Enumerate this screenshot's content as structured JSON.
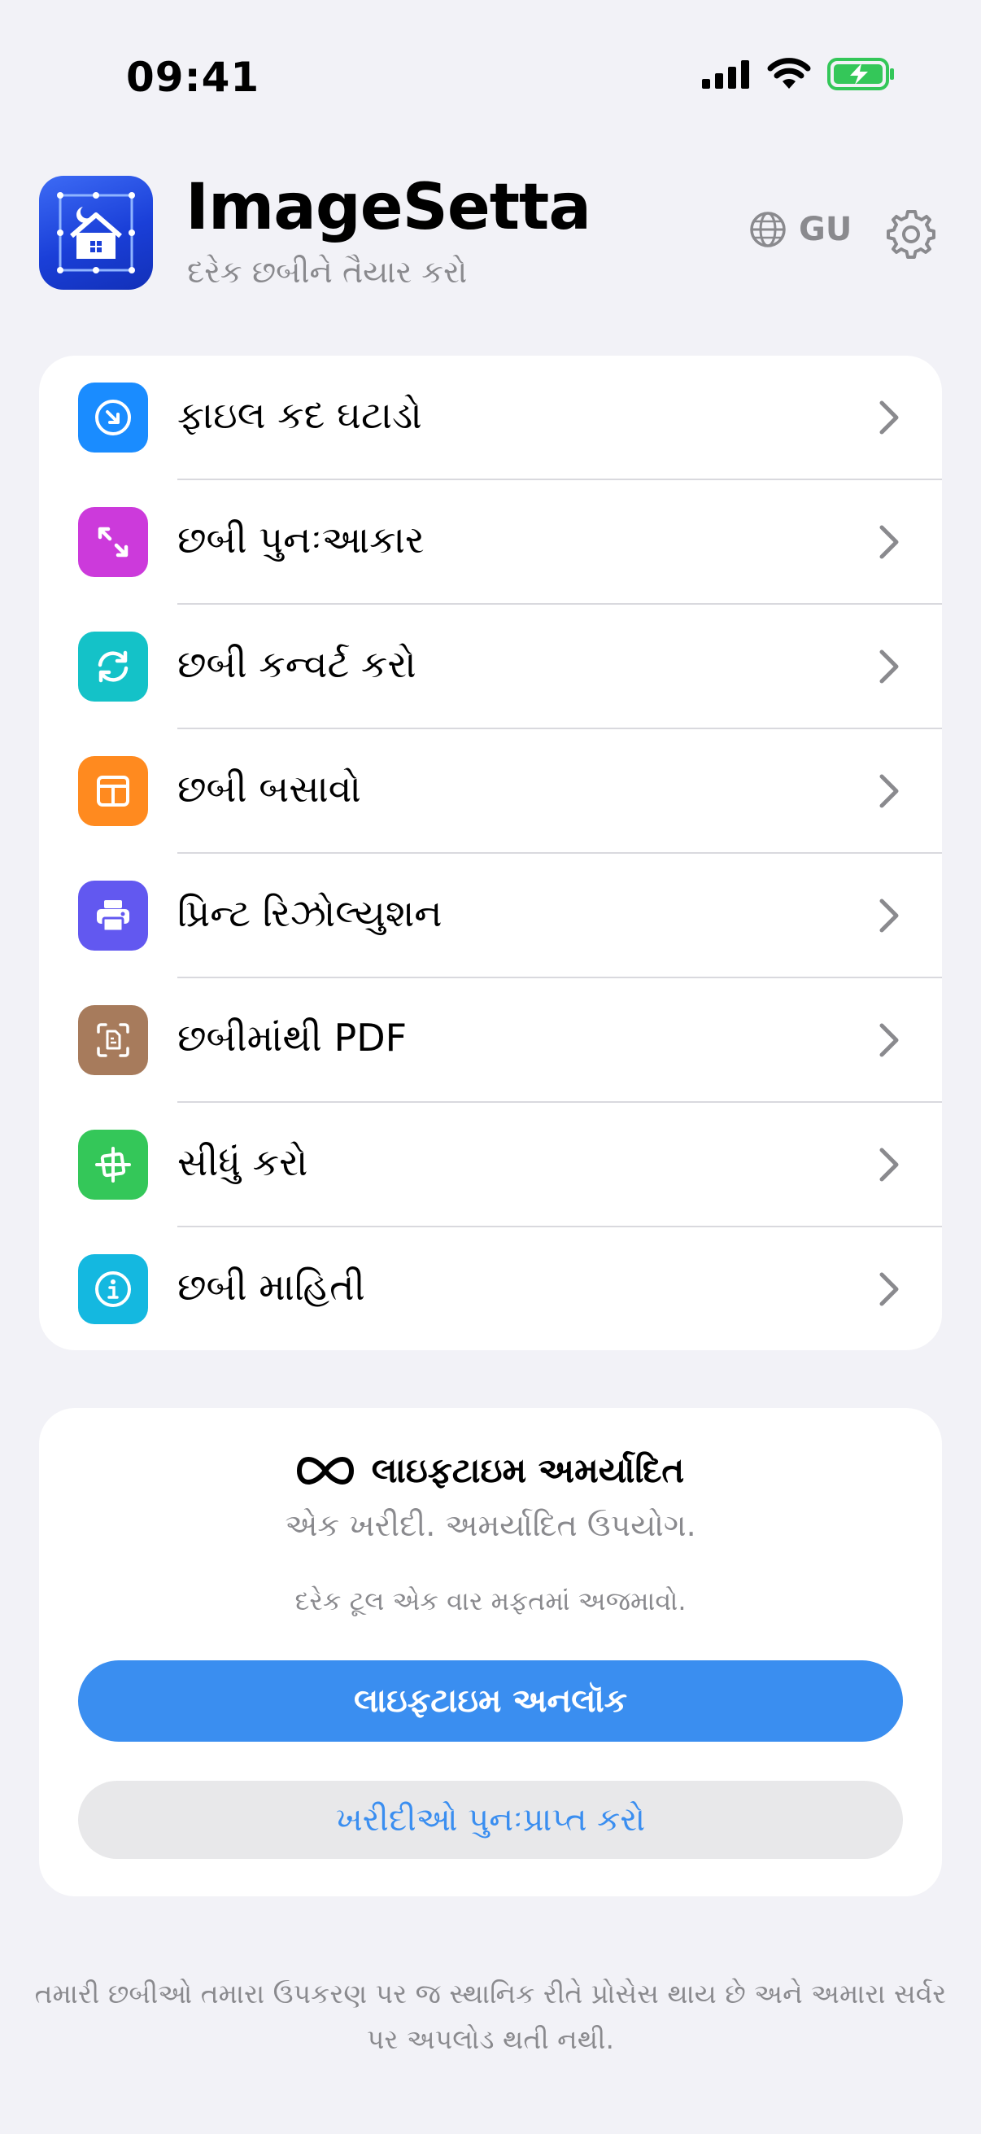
{
  "status_bar": {
    "time": "09:41"
  },
  "header": {
    "app_title": "ImageSetta",
    "app_subtitle": "દરેક છબીને તૈયાર કરો",
    "language_code": "GU"
  },
  "menu": {
    "items": [
      {
        "label": "ફાઇલ કદ ઘટાડો",
        "icon": "compress-arrow-icon",
        "color": "#1A8CFF"
      },
      {
        "label": "છબી પુનઃઆકાર",
        "icon": "resize-arrows-icon",
        "color": "#CC3ADB"
      },
      {
        "label": "છબી કન્વર્ટ કરો",
        "icon": "convert-cycle-icon",
        "color": "#14C2C8"
      },
      {
        "label": "છબી બસાવો",
        "icon": "fit-frame-icon",
        "color": "#FF8A1F"
      },
      {
        "label": "પ્રિન્ટ રિઝોલ્યુશન",
        "icon": "printer-icon",
        "color": "#6258F0"
      },
      {
        "label": "છબીમાંથી PDF",
        "icon": "pdf-document-icon",
        "color": "#A77B5C"
      },
      {
        "label": "સીધું કરો",
        "icon": "crop-straighten-icon",
        "color": "#34C759"
      },
      {
        "label": "છબી માહિતી",
        "icon": "info-icon",
        "color": "#14B8E0"
      }
    ]
  },
  "purchase": {
    "title": "લાઇફટાઇમ અમર્યાદિત",
    "subtitle": "એક ખરીદી. અમર્યાદિત ઉપયોગ.",
    "trial_note": "દરેક ટૂલ એક વાર મફતમાં અજમાવો.",
    "unlock_label": "લાઇફટાઇમ અનલૉક",
    "restore_label": "ખરીદીઓ પુનઃપ્રાપ્ત કરો",
    "accent_color": "#3A8EF0"
  },
  "footer": {
    "privacy_note": "તમારી છબીઓ તમારા ઉપકરણ પર જ સ્થાનિક રીતે પ્રોસેસ થાય છે અને અમારા સર્વર પર અપલોડ થતી નથી."
  }
}
